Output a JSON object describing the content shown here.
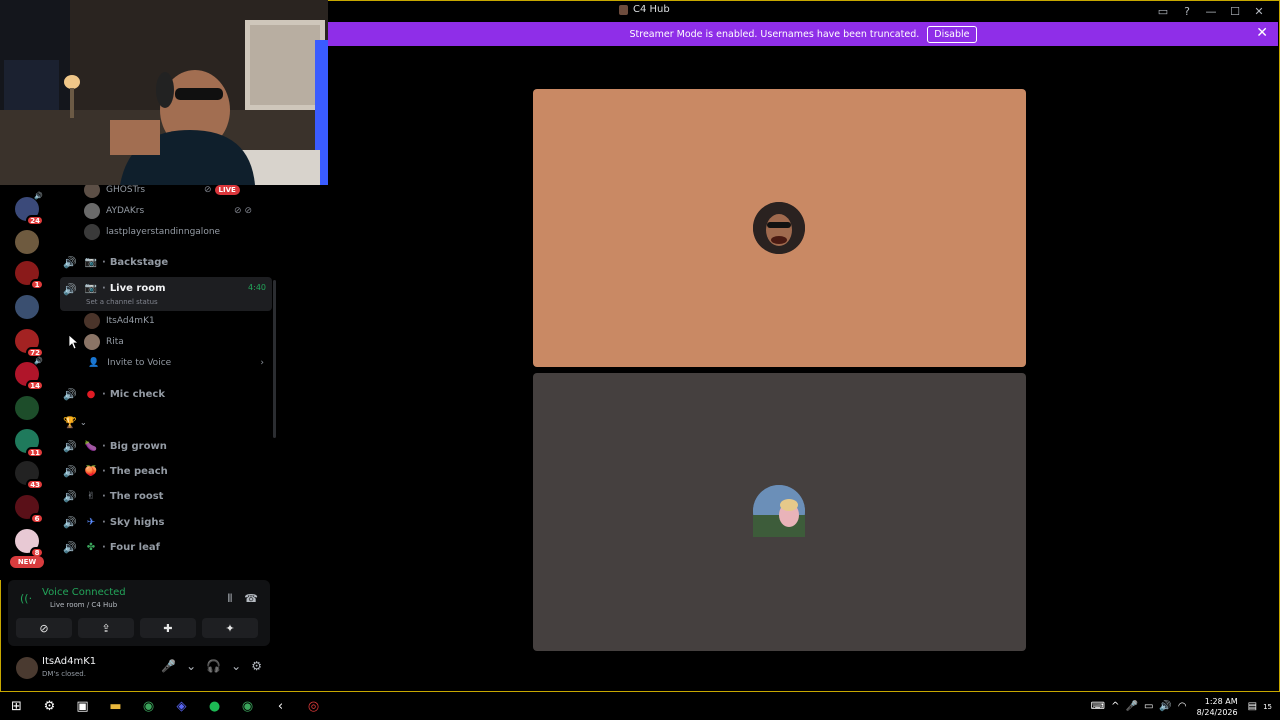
{
  "window": {
    "title": "C4 Hub",
    "titlebar_icons": [
      "inbox-icon",
      "help-icon",
      "minimize-icon",
      "maximize-icon",
      "close-icon"
    ]
  },
  "banner": {
    "message": "Streamer Mode is enabled. Usernames have been truncated.",
    "button": "Disable",
    "close": "✕"
  },
  "guild_badges": [
    "24",
    "1",
    "72",
    "14",
    "11",
    "43",
    "6",
    "8"
  ],
  "guild_new_label": "NEW",
  "members_top": [
    {
      "name": "GHOSTrs",
      "live": "LIVE"
    },
    {
      "name": "AYDAKrs"
    },
    {
      "name": "lastplayerstandinngalone"
    }
  ],
  "channels": {
    "backstage": "Backstage",
    "live_room": "Live room",
    "live_room_timer": "4:40",
    "live_room_status": "Set a channel status",
    "live_members": [
      "ItsAd4mK1",
      "Rita"
    ],
    "invite": "Invite to Voice",
    "mic_check": "Mic check",
    "category_icon": "🏆",
    "list": [
      {
        "emoji": "🍆",
        "name": "Big grown"
      },
      {
        "emoji": "🍑",
        "name": "The peach"
      },
      {
        "emoji": "✌",
        "name": "The roost"
      },
      {
        "emoji": "✈",
        "name": "Sky highs"
      },
      {
        "emoji": "✤",
        "name": "Four leaf"
      }
    ]
  },
  "voice": {
    "title": "Voice Connected",
    "subtitle": "Live room / C4 Hub"
  },
  "user": {
    "name": "ItsAd4mK1",
    "status": "DM's closed."
  },
  "stage": {
    "tile1_color": "#c98964",
    "tile2_color": "#45403f"
  },
  "taskbar": {
    "time": "1:28 AM",
    "date": "8/24/2026",
    "notification_count": "15"
  }
}
